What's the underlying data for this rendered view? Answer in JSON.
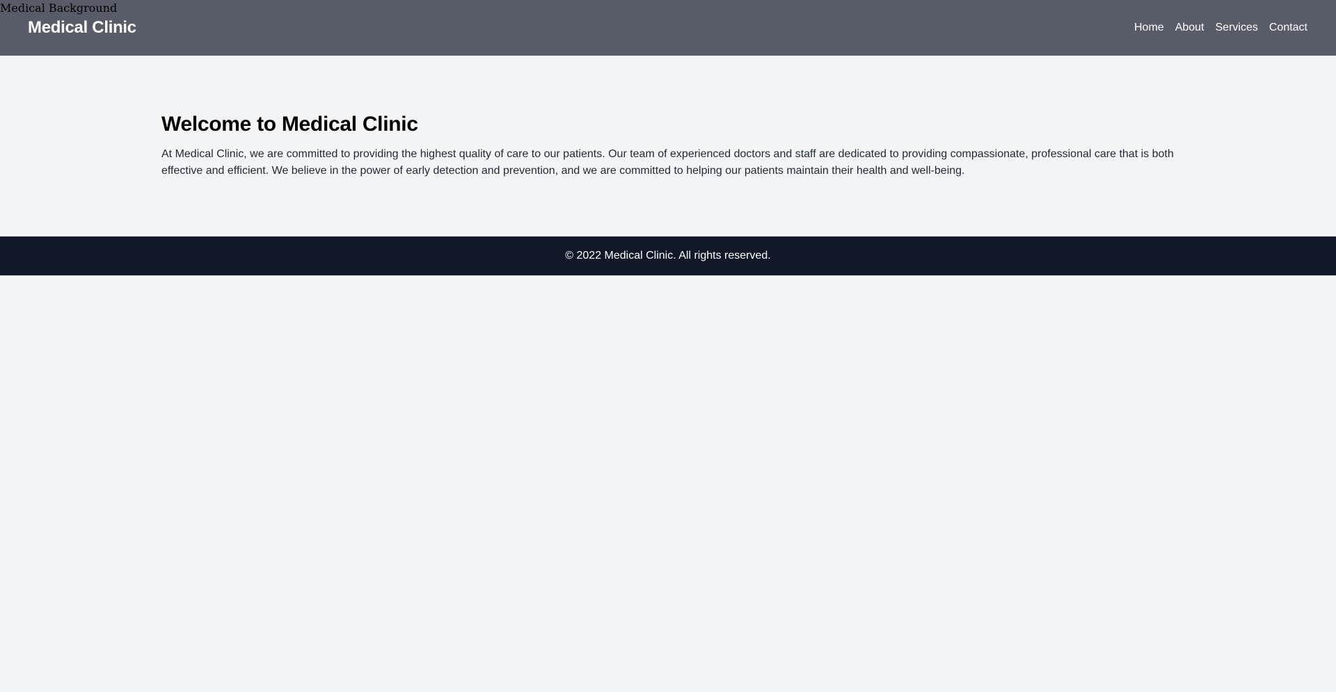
{
  "background_image": {
    "alt": "Medical Background"
  },
  "header": {
    "brand": "Medical Clinic",
    "nav": [
      {
        "label": "Home"
      },
      {
        "label": "About"
      },
      {
        "label": "Services"
      },
      {
        "label": "Contact"
      }
    ]
  },
  "main": {
    "title": "Welcome to Medical Clinic",
    "body": "At Medical Clinic, we are committed to providing the highest quality of care to our patients. Our team of experienced doctors and staff are dedicated to providing compassionate, professional care that is both effective and efficient. We believe in the power of early detection and prevention, and we are committed to helping our patients maintain their health and well-being."
  },
  "footer": {
    "text": "© 2022 Medical Clinic. All rights reserved."
  },
  "colors": {
    "navbar": "#585c68",
    "page_background": "#f3f4f6",
    "footer": "#111827",
    "body_text": "#1f2937"
  }
}
